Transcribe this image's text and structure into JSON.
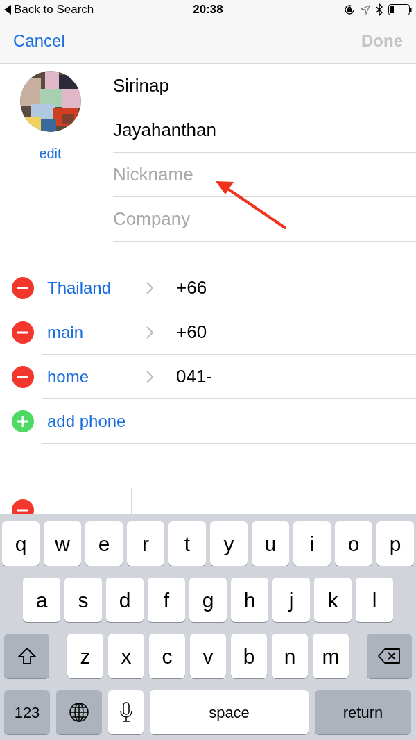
{
  "status_bar": {
    "back": "Back to Search",
    "time": "20:38"
  },
  "nav": {
    "cancel": "Cancel",
    "done": {
      "label": "Done",
      "disabled": true
    }
  },
  "photo": {
    "edit": "edit"
  },
  "name_fields": [
    {
      "value": "Sirinap"
    },
    {
      "value": "Jayahanthan"
    },
    {
      "placeholder": "Nickname"
    },
    {
      "placeholder": "Company"
    }
  ],
  "phones": [
    {
      "label": "Thailand",
      "value": "+66"
    },
    {
      "label": "main",
      "value": "+60"
    },
    {
      "label": "home",
      "value": "041-"
    }
  ],
  "add_phone": "add phone",
  "keyboard": {
    "top_row": [
      {
        "kind": "letter",
        "label": "q"
      },
      {
        "kind": "letter",
        "label": "w"
      },
      {
        "kind": "letter",
        "label": "e"
      },
      {
        "kind": "letter",
        "label": "r"
      },
      {
        "kind": "letter",
        "label": "t"
      },
      {
        "kind": "letter",
        "label": "y"
      },
      {
        "kind": "letter",
        "label": "u"
      },
      {
        "kind": "letter",
        "label": "i"
      },
      {
        "kind": "letter",
        "label": "o"
      },
      {
        "kind": "letter",
        "label": "p"
      }
    ],
    "middle_row": [
      {
        "kind": "letter",
        "label": "a"
      },
      {
        "kind": "letter",
        "label": "s"
      },
      {
        "kind": "letter",
        "label": "d"
      },
      {
        "kind": "letter",
        "label": "f"
      },
      {
        "kind": "letter",
        "label": "g"
      },
      {
        "kind": "letter",
        "label": "h"
      },
      {
        "kind": "letter",
        "label": "j"
      },
      {
        "kind": "letter",
        "label": "k"
      },
      {
        "kind": "letter",
        "label": "l"
      }
    ],
    "third_row": [
      {
        "kind": "shift"
      },
      {
        "kind": "letter",
        "label": "z"
      },
      {
        "kind": "letter",
        "label": "x"
      },
      {
        "kind": "letter",
        "label": "c"
      },
      {
        "kind": "letter",
        "label": "v"
      },
      {
        "kind": "letter",
        "label": "b"
      },
      {
        "kind": "letter",
        "label": "n"
      },
      {
        "kind": "letter",
        "label": "m"
      },
      {
        "kind": "delete"
      }
    ],
    "bottom_row": [
      {
        "kind": "numbers",
        "label": "123"
      },
      {
        "kind": "globe"
      },
      {
        "kind": "mic"
      },
      {
        "kind": "space",
        "label": "space"
      },
      {
        "kind": "return",
        "label": "return"
      }
    ]
  }
}
